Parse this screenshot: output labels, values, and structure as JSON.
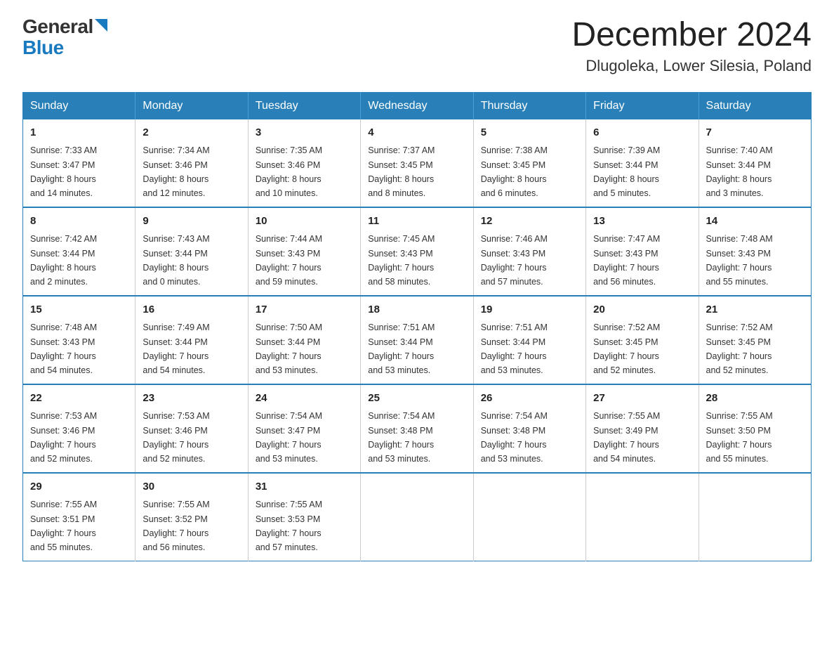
{
  "header": {
    "logo_general": "General",
    "logo_blue": "Blue",
    "month_title": "December 2024",
    "location": "Dlugoleka, Lower Silesia, Poland"
  },
  "days_of_week": [
    "Sunday",
    "Monday",
    "Tuesday",
    "Wednesday",
    "Thursday",
    "Friday",
    "Saturday"
  ],
  "weeks": [
    [
      {
        "day": "1",
        "sunrise": "7:33 AM",
        "sunset": "3:47 PM",
        "daylight": "8 hours and 14 minutes."
      },
      {
        "day": "2",
        "sunrise": "7:34 AM",
        "sunset": "3:46 PM",
        "daylight": "8 hours and 12 minutes."
      },
      {
        "day": "3",
        "sunrise": "7:35 AM",
        "sunset": "3:46 PM",
        "daylight": "8 hours and 10 minutes."
      },
      {
        "day": "4",
        "sunrise": "7:37 AM",
        "sunset": "3:45 PM",
        "daylight": "8 hours and 8 minutes."
      },
      {
        "day": "5",
        "sunrise": "7:38 AM",
        "sunset": "3:45 PM",
        "daylight": "8 hours and 6 minutes."
      },
      {
        "day": "6",
        "sunrise": "7:39 AM",
        "sunset": "3:44 PM",
        "daylight": "8 hours and 5 minutes."
      },
      {
        "day": "7",
        "sunrise": "7:40 AM",
        "sunset": "3:44 PM",
        "daylight": "8 hours and 3 minutes."
      }
    ],
    [
      {
        "day": "8",
        "sunrise": "7:42 AM",
        "sunset": "3:44 PM",
        "daylight": "8 hours and 2 minutes."
      },
      {
        "day": "9",
        "sunrise": "7:43 AM",
        "sunset": "3:44 PM",
        "daylight": "8 hours and 0 minutes."
      },
      {
        "day": "10",
        "sunrise": "7:44 AM",
        "sunset": "3:43 PM",
        "daylight": "7 hours and 59 minutes."
      },
      {
        "day": "11",
        "sunrise": "7:45 AM",
        "sunset": "3:43 PM",
        "daylight": "7 hours and 58 minutes."
      },
      {
        "day": "12",
        "sunrise": "7:46 AM",
        "sunset": "3:43 PM",
        "daylight": "7 hours and 57 minutes."
      },
      {
        "day": "13",
        "sunrise": "7:47 AM",
        "sunset": "3:43 PM",
        "daylight": "7 hours and 56 minutes."
      },
      {
        "day": "14",
        "sunrise": "7:48 AM",
        "sunset": "3:43 PM",
        "daylight": "7 hours and 55 minutes."
      }
    ],
    [
      {
        "day": "15",
        "sunrise": "7:48 AM",
        "sunset": "3:43 PM",
        "daylight": "7 hours and 54 minutes."
      },
      {
        "day": "16",
        "sunrise": "7:49 AM",
        "sunset": "3:44 PM",
        "daylight": "7 hours and 54 minutes."
      },
      {
        "day": "17",
        "sunrise": "7:50 AM",
        "sunset": "3:44 PM",
        "daylight": "7 hours and 53 minutes."
      },
      {
        "day": "18",
        "sunrise": "7:51 AM",
        "sunset": "3:44 PM",
        "daylight": "7 hours and 53 minutes."
      },
      {
        "day": "19",
        "sunrise": "7:51 AM",
        "sunset": "3:44 PM",
        "daylight": "7 hours and 53 minutes."
      },
      {
        "day": "20",
        "sunrise": "7:52 AM",
        "sunset": "3:45 PM",
        "daylight": "7 hours and 52 minutes."
      },
      {
        "day": "21",
        "sunrise": "7:52 AM",
        "sunset": "3:45 PM",
        "daylight": "7 hours and 52 minutes."
      }
    ],
    [
      {
        "day": "22",
        "sunrise": "7:53 AM",
        "sunset": "3:46 PM",
        "daylight": "7 hours and 52 minutes."
      },
      {
        "day": "23",
        "sunrise": "7:53 AM",
        "sunset": "3:46 PM",
        "daylight": "7 hours and 52 minutes."
      },
      {
        "day": "24",
        "sunrise": "7:54 AM",
        "sunset": "3:47 PM",
        "daylight": "7 hours and 53 minutes."
      },
      {
        "day": "25",
        "sunrise": "7:54 AM",
        "sunset": "3:48 PM",
        "daylight": "7 hours and 53 minutes."
      },
      {
        "day": "26",
        "sunrise": "7:54 AM",
        "sunset": "3:48 PM",
        "daylight": "7 hours and 53 minutes."
      },
      {
        "day": "27",
        "sunrise": "7:55 AM",
        "sunset": "3:49 PM",
        "daylight": "7 hours and 54 minutes."
      },
      {
        "day": "28",
        "sunrise": "7:55 AM",
        "sunset": "3:50 PM",
        "daylight": "7 hours and 55 minutes."
      }
    ],
    [
      {
        "day": "29",
        "sunrise": "7:55 AM",
        "sunset": "3:51 PM",
        "daylight": "7 hours and 55 minutes."
      },
      {
        "day": "30",
        "sunrise": "7:55 AM",
        "sunset": "3:52 PM",
        "daylight": "7 hours and 56 minutes."
      },
      {
        "day": "31",
        "sunrise": "7:55 AM",
        "sunset": "3:53 PM",
        "daylight": "7 hours and 57 minutes."
      },
      null,
      null,
      null,
      null
    ]
  ],
  "labels": {
    "sunrise": "Sunrise:",
    "sunset": "Sunset:",
    "daylight": "Daylight:"
  }
}
